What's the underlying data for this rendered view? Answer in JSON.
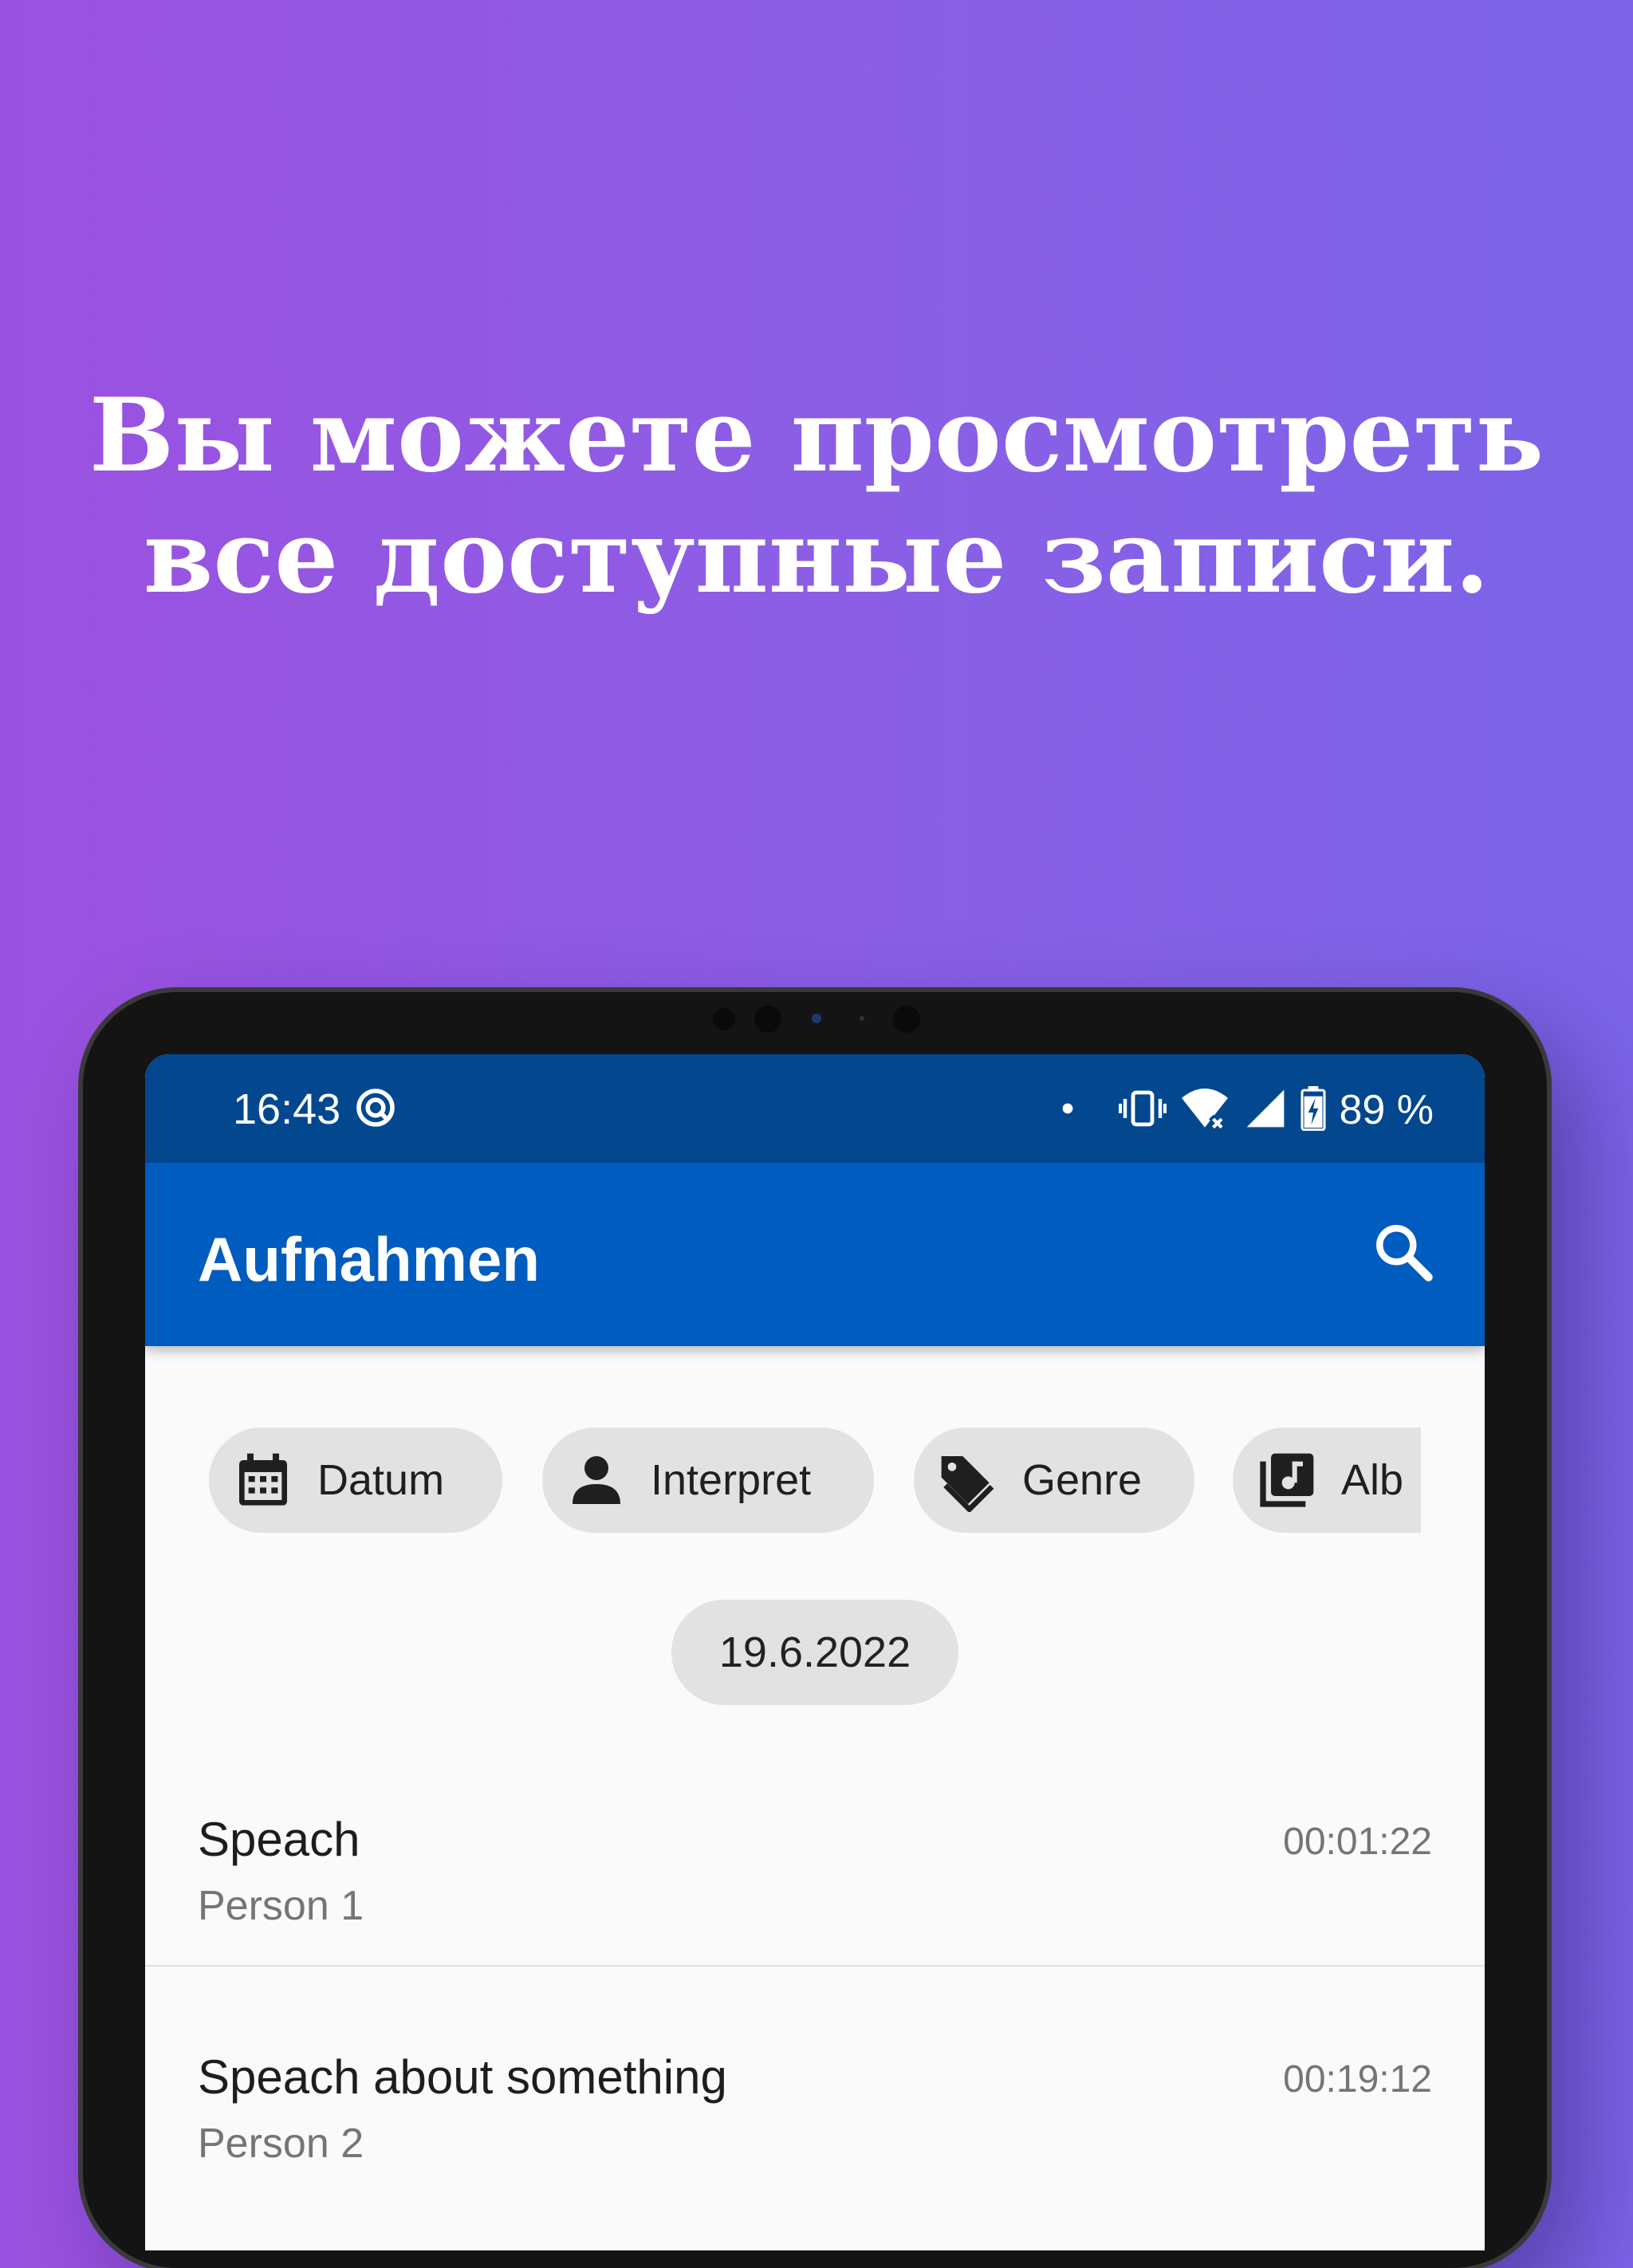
{
  "promo": {
    "headline_line1": "Вы можете просмотреть",
    "headline_line2": "все доступные записи."
  },
  "status_bar": {
    "time": "16:43",
    "battery": "89 %",
    "icons": [
      "data-saver-icon",
      "dot-icon",
      "vibrate-icon",
      "wifi-icon",
      "signal-icon",
      "battery-charging-icon"
    ]
  },
  "app_bar": {
    "title": "Aufnahmen",
    "search_icon": "search-icon"
  },
  "filter_chips": [
    {
      "label": "Datum",
      "icon": "calendar-icon"
    },
    {
      "label": "Interpret",
      "icon": "person-icon"
    },
    {
      "label": "Genre",
      "icon": "tag-icon"
    },
    {
      "label": "Alb",
      "icon": "album-icon"
    }
  ],
  "date_header": "19.6.2022",
  "recordings": [
    {
      "title": "Speach",
      "artist": "Person 1",
      "duration": "00:01:22"
    },
    {
      "title": "Speach about something",
      "artist": "Person 2",
      "duration": "00:19:12"
    }
  ],
  "colors": {
    "background_start": "#9b51e0",
    "background_end": "#7b64e8",
    "status_bar": "#03478f",
    "app_bar": "#005cbe",
    "chip": "#e2e2e2"
  }
}
